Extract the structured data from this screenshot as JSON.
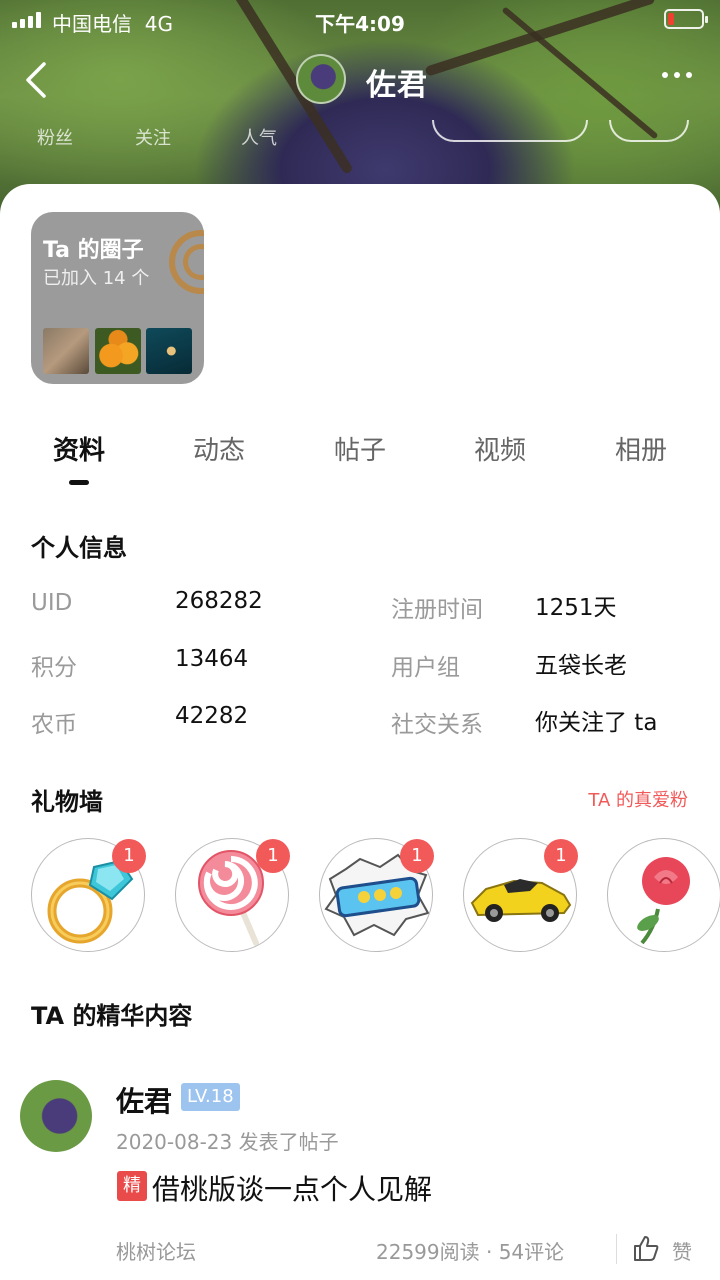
{
  "status_bar": {
    "carrier": "中国电信",
    "network": "4G",
    "time": "下午4:09"
  },
  "header": {
    "username": "佐君",
    "stats": [
      "粉丝",
      "关注",
      "人气"
    ]
  },
  "circle_card": {
    "title": "Ta 的圈子",
    "subtitle": "已加入 14 个"
  },
  "tabs": [
    {
      "label": "资料",
      "active": true
    },
    {
      "label": "动态",
      "active": false
    },
    {
      "label": "帖子",
      "active": false
    },
    {
      "label": "视频",
      "active": false
    },
    {
      "label": "相册",
      "active": false
    }
  ],
  "personal_info": {
    "title": "个人信息",
    "rows": [
      {
        "left_label": "UID",
        "left_value": "268282",
        "right_label": "注册时间",
        "right_value": "1251天"
      },
      {
        "left_label": "积分",
        "left_value": "13464",
        "right_label": "用户组",
        "right_value": "五袋长老"
      },
      {
        "left_label": "农币",
        "left_value": "42282",
        "right_label": "社交关系",
        "right_value": "你关注了 ta"
      }
    ]
  },
  "gift_wall": {
    "title": "礼物墙",
    "link": "TA 的真爱粉",
    "gifts": [
      {
        "icon": "diamond-ring-icon",
        "count": "1"
      },
      {
        "icon": "lollipop-icon",
        "count": "1"
      },
      {
        "icon": "cool-sticker-icon",
        "count": "1"
      },
      {
        "icon": "sports-car-icon",
        "count": "1"
      },
      {
        "icon": "rose-icon",
        "count": ""
      }
    ]
  },
  "featured": {
    "title": "TA 的精华内容",
    "post": {
      "author": "佐君",
      "level": "LV.18",
      "meta": "2020-08-23 发表了帖子",
      "tag": "精",
      "title": "借桃版谈一点个人见解",
      "forum": "桃树论坛",
      "stats": "22599阅读 · 54评论",
      "like_label": "赞"
    }
  },
  "colors": {
    "accent_red": "#f25a5a",
    "level_blue": "#9dc3ef",
    "essence_red": "#e94b4b"
  }
}
